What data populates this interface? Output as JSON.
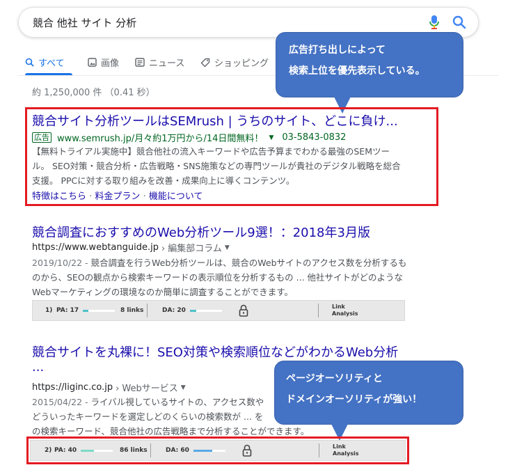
{
  "search": {
    "query": "競合 他社 サイト 分析"
  },
  "tabs": [
    {
      "label": "すべて",
      "icon": "search-icon",
      "active": true
    },
    {
      "label": "画像",
      "icon": "image-icon"
    },
    {
      "label": "ニュース",
      "icon": "newspaper-icon"
    },
    {
      "label": "ショッピング",
      "icon": "tag-icon"
    }
  ],
  "stats": "約 1,250,000 件 （0.41 秒）",
  "callouts": {
    "top": {
      "line1": "広告打ち出しによって",
      "line2": "検索上位を優先表示している。",
      "color": "#4472c4"
    },
    "bottom": {
      "line1": "ページオーソリティと",
      "line2": "ドメインオーソリティが強い！",
      "color": "#4472c4"
    }
  },
  "result_ad": {
    "title": "競合サイト分析ツールはSEMrush | うちのサイト、どこに負け...",
    "badge": "広告",
    "url": "www.semrush.jp/月々約1万円から/14日間無料！",
    "phone": "03-5843-0832",
    "snippet_lines": [
      "【無料トライアル実施中】競合他社の流入キーワードや広告予算までわかる最強のSEMツー",
      "ル。 SEO対策・競合分析・広告戦略・SNS施策などの専門ツールが貴社のデジタル戦略を総合",
      "支援。 PPCに対する取り組みを改善・成果向上に導くコンテンツ。"
    ],
    "sitelinks": [
      "特徴はこちら",
      "料金プラン",
      "機能について"
    ]
  },
  "result1": {
    "title": "競合調査におすすめのWeb分析ツール9選！：2018年3月版",
    "url": "https://www.webtanguide.jp",
    "breadcrumb": "› 編集部コラム",
    "date": "2019/10/22 - ",
    "snippet_lines": [
      "競合調査を行うWeb分析ツールは、競合のWebサイトのアクセス数を分析するも",
      "のから、SEOの観点から検索キーワードの表示順位を分析するもの ... 他社サイトがどのような",
      "Webマーケティングの環境なのか簡単に調査することができます。"
    ],
    "moz": {
      "index": "1)",
      "pa_label": "PA: 17",
      "pa_value": 17,
      "links": "8 links",
      "da_label": "DA: 20",
      "da_value": 20,
      "link_analysis": [
        "Link",
        "Analysis"
      ],
      "bar_color": "#4fc1c9"
    }
  },
  "result2": {
    "title_line1": "競合サイトを丸裸に！SEO対策や検索順位などがわかるWeb分析",
    "title_line2": "...",
    "url": "https://liginc.co.jp",
    "breadcrumb": "› Webサービス",
    "date": "2015/04/22 - ",
    "snippet_lines": [
      "ライバル視しているサイトの、アクセス数や",
      "どういったキーワードを選定しどのくらいの検索数が ... を",
      "の検索キーワード、競合他社の広告戦略まで分析することができます。"
    ],
    "moz": {
      "index": "2)",
      "pa_label": "PA: 40",
      "pa_value": 40,
      "links": "86 links",
      "da_label": "DA: 60",
      "da_value": 60,
      "link_analysis": [
        "Link",
        "Analysis"
      ],
      "pa_color": "#7ed9c5",
      "da_color": "#5aa9e6"
    }
  }
}
